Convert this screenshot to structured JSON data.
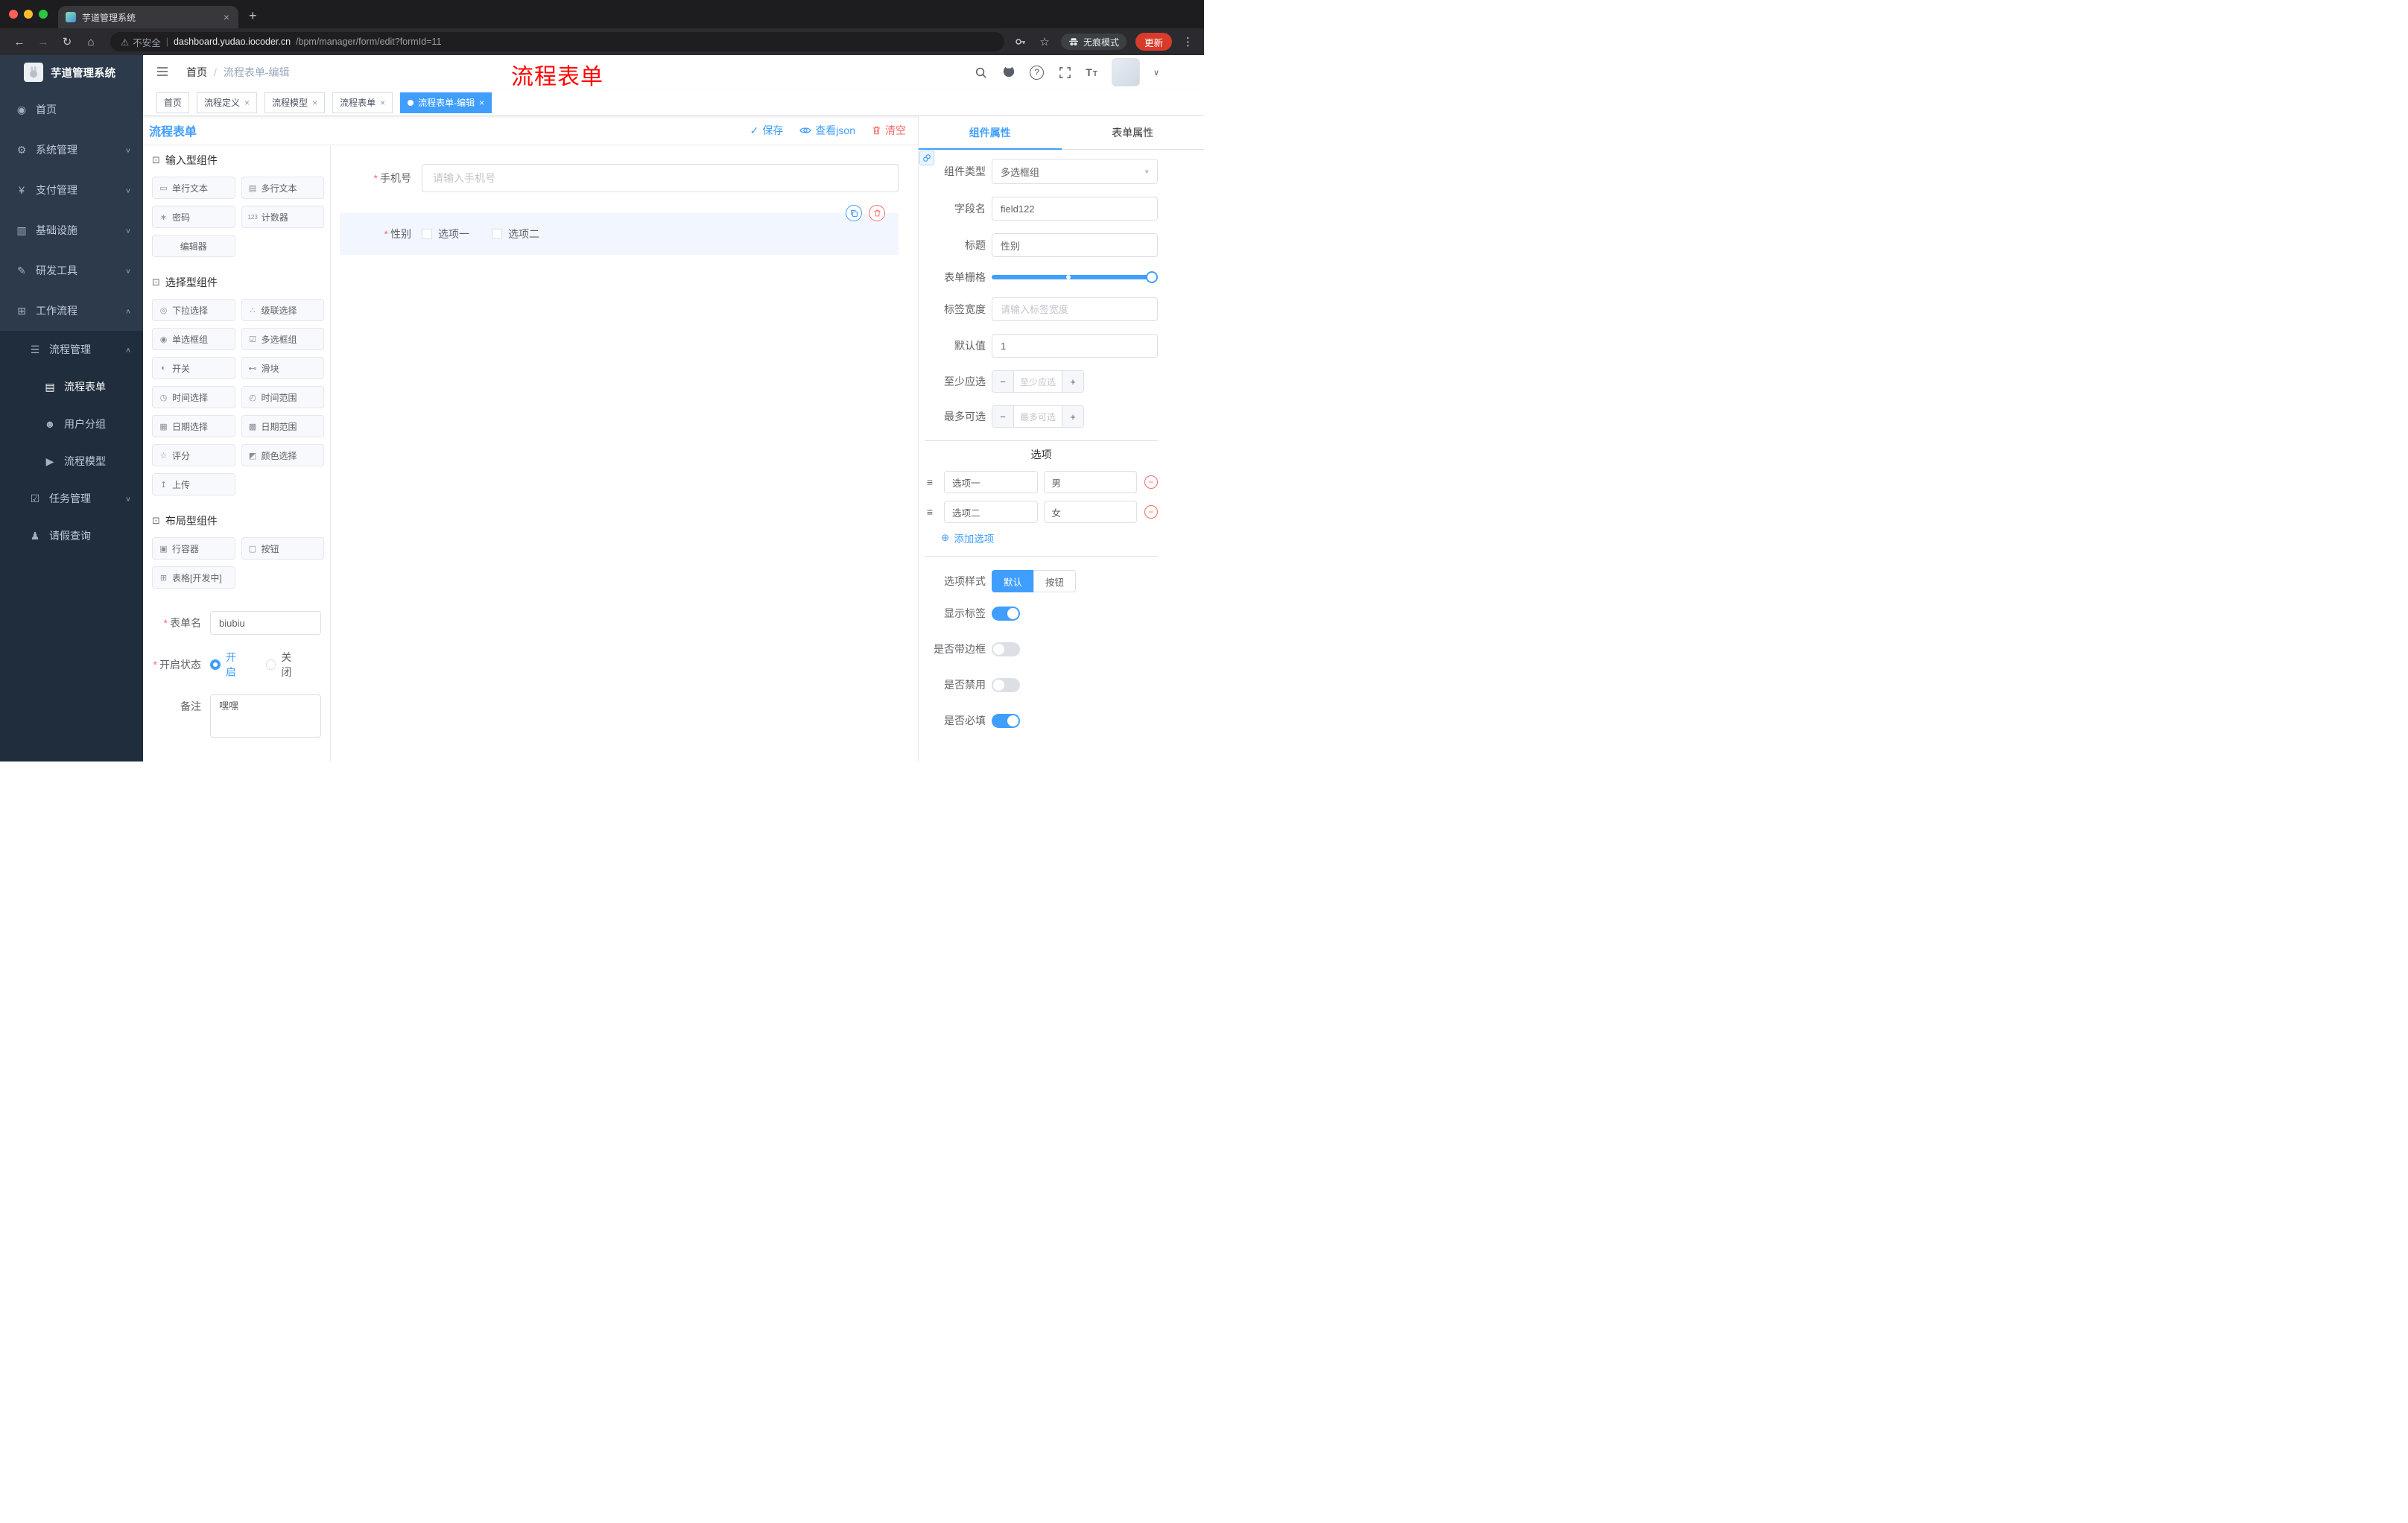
{
  "ui": {
    "close": "×",
    "plus": "+",
    "minus": "−",
    "caret_down": "∨",
    "caret_up": "∧",
    "select_caret": "▾",
    "dots": "⋮",
    "back": "←",
    "forward": "→",
    "reload": "↻",
    "home": "⌂",
    "star": "☆",
    "warning": "⚠",
    "divider": "|",
    "check": "✓",
    "add": "⊕",
    "drag": "≡",
    "section": "⊡"
  },
  "colors": {
    "accent": "#409eff",
    "danger": "#f56c6c",
    "annotation": "#fe0600",
    "sidebar_bg": "#2d3a4b",
    "sidebar_sub_bg": "#1f2d3d"
  },
  "browser": {
    "tab_title": "芋道管理系统",
    "address": {
      "warning": "不安全",
      "domain": "dashboard.yudao.iocoder.cn",
      "path": "/bpm/manager/form/edit?formId=11"
    },
    "incognito_label": "无痕模式",
    "update_label": "更新"
  },
  "sidebar": {
    "logo_title": "芋道管理系统",
    "icons": [
      "◉",
      "⚙",
      "¥",
      "▥",
      "✎",
      "⊞",
      "☰",
      "▤",
      "☻",
      "▶",
      "☑",
      "♟"
    ],
    "items": [
      {
        "label": "首页"
      },
      {
        "label": "系统管理"
      },
      {
        "label": "支付管理"
      },
      {
        "label": "基础设施"
      },
      {
        "label": "研发工具"
      },
      {
        "label": "工作流程"
      },
      {
        "label": "流程管理"
      },
      {
        "label": "流程表单"
      },
      {
        "label": "用户分组"
      },
      {
        "label": "流程模型"
      },
      {
        "label": "任务管理"
      },
      {
        "label": "请假查询"
      }
    ]
  },
  "header": {
    "breadcrumb_root": "首页",
    "breadcrumb_sep": "/",
    "breadcrumb_current": "流程表单-编辑",
    "annotation": "流程表单"
  },
  "tags": [
    {
      "label": "首页"
    },
    {
      "label": "流程定义"
    },
    {
      "label": "流程模型"
    },
    {
      "label": "流程表单"
    },
    {
      "label": "流程表单-编辑"
    }
  ],
  "designer": {
    "title": "流程表单",
    "save": "保存",
    "view_json": "查看json",
    "clear": "清空",
    "groups": [
      {
        "title": "输入型组件",
        "icons": [
          "▭",
          "▤",
          "∗",
          "123",
          ""
        ],
        "items": [
          "单行文本",
          "多行文本",
          "密码",
          "计数器",
          "编辑器"
        ]
      },
      {
        "title": "选择型组件",
        "icons": [
          "◎",
          "∴",
          "◉",
          "☑",
          "◐",
          "⊷",
          "◷",
          "◴",
          "▦",
          "▩",
          "☆",
          "◩",
          "↥"
        ],
        "items": [
          "下拉选择",
          "级联选择",
          "单选框组",
          "多选框组",
          "开关",
          "滑块",
          "时间选择",
          "时间范围",
          "日期选择",
          "日期范围",
          "评分",
          "颜色选择",
          "上传"
        ]
      },
      {
        "title": "布局型组件",
        "icons": [
          "▣",
          "▢",
          "⊞"
        ],
        "items": [
          "行容器",
          "按钮",
          "表格[开发中]"
        ]
      }
    ],
    "meta": {
      "name_label": "表单名",
      "name_value": "biubiu",
      "status_label": "开启状态",
      "status_on": "开启",
      "status_off": "关闭",
      "remark_label": "备注",
      "remark_value": "嘿嘿"
    },
    "canvas": {
      "phone_label": "手机号",
      "phone_placeholder": "请输入手机号",
      "gender_label": "性别",
      "gender_opt1": "选项一",
      "gender_opt2": "选项二"
    }
  },
  "props": {
    "tab_component": "组件属性",
    "tab_form": "表单属性",
    "type_label": "组件类型",
    "type_value": "多选框组",
    "field_label": "字段名",
    "field_value": "field122",
    "title_label": "标题",
    "title_value": "性别",
    "grid_label": "表单栅格",
    "width_label": "标签宽度",
    "width_placeholder": "请输入标签宽度",
    "default_label": "默认值",
    "default_value": "1",
    "min_label": "至少应选",
    "min_placeholder": "至少应选",
    "max_label": "最多可选",
    "max_placeholder": "最多可选",
    "options_title": "选项",
    "options": [
      {
        "label": "选项一",
        "value": "男"
      },
      {
        "label": "选项二",
        "value": "女"
      }
    ],
    "add_option": "添加选项",
    "style_label": "选项样式",
    "style_default": "默认",
    "style_button": "按钮",
    "switch_show_label": "显示标签",
    "switch_border": "是否带边框",
    "switch_disabled": "是否禁用",
    "switch_required": "是否必填"
  }
}
